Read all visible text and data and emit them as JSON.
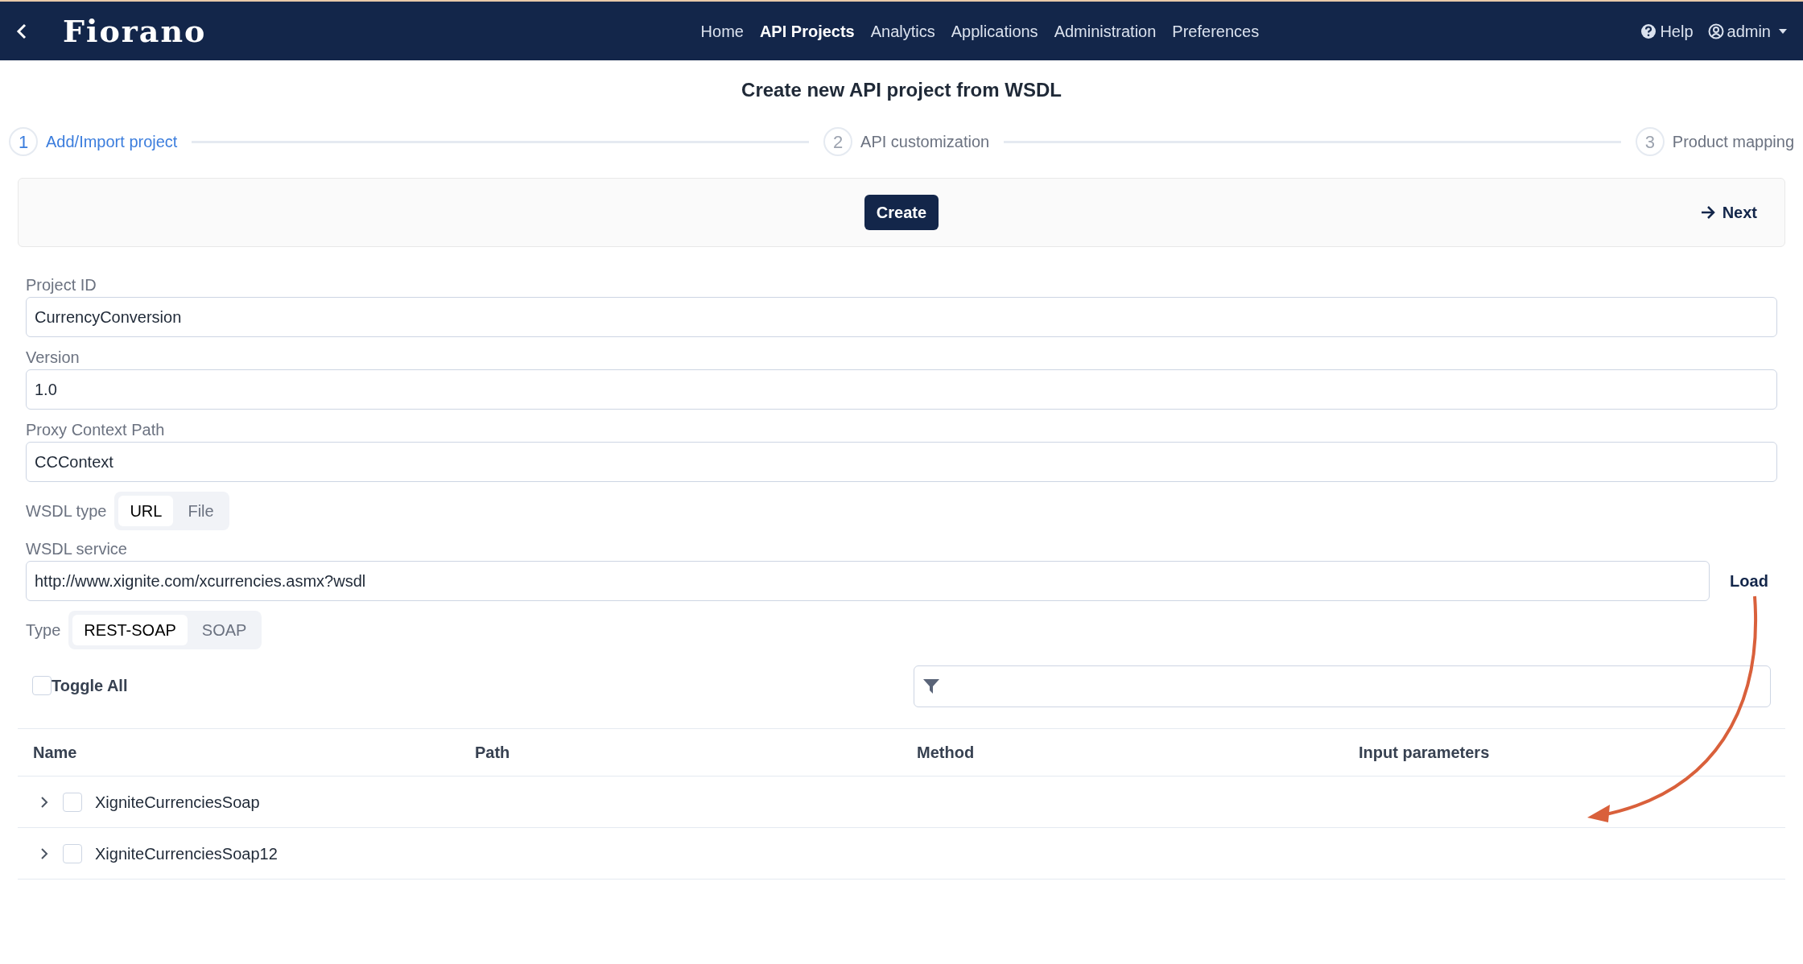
{
  "header": {
    "logo": "Fiorano",
    "nav": [
      {
        "label": "Home",
        "selected": false
      },
      {
        "label": "API Projects",
        "selected": true
      },
      {
        "label": "Analytics",
        "selected": false
      },
      {
        "label": "Applications",
        "selected": false
      },
      {
        "label": "Administration",
        "selected": false
      },
      {
        "label": "Preferences",
        "selected": false
      }
    ],
    "help": "Help",
    "user": "admin"
  },
  "page_title": "Create new API project from WSDL",
  "steps": [
    {
      "number": "1",
      "label": "Add/Import project",
      "selected": true
    },
    {
      "number": "2",
      "label": "API customization",
      "selected": false
    },
    {
      "number": "3",
      "label": "Product mapping",
      "selected": false
    }
  ],
  "toolbar": {
    "create": "Create",
    "next": "Next"
  },
  "fields": [
    {
      "label": "Project ID",
      "value": "CurrencyConversion"
    },
    {
      "label": "Version",
      "value": "1.0"
    },
    {
      "label": "Proxy Context Path",
      "value": "CCContext"
    }
  ],
  "wsdl_type": {
    "label": "WSDL type",
    "options": [
      {
        "label": "URL",
        "selected": true
      },
      {
        "label": "File",
        "selected": false
      }
    ]
  },
  "wsdl_service": {
    "label": "WSDL service",
    "value": "http://www.xignite.com/xcurrencies.asmx?wsdl",
    "load": "Load"
  },
  "type": {
    "label": "Type",
    "options": [
      {
        "label": "REST-SOAP",
        "selected": true
      },
      {
        "label": "SOAP",
        "selected": false
      }
    ]
  },
  "toggle_all": {
    "label": "Toggle All",
    "checked": false
  },
  "table": {
    "columns": [
      "Name",
      "Path",
      "Method",
      "Input parameters"
    ],
    "rows": [
      {
        "name": "XigniteCurrenciesSoap",
        "expanded": false,
        "checked": false
      },
      {
        "name": "XigniteCurrenciesSoap12",
        "expanded": false,
        "checked": false
      }
    ]
  }
}
